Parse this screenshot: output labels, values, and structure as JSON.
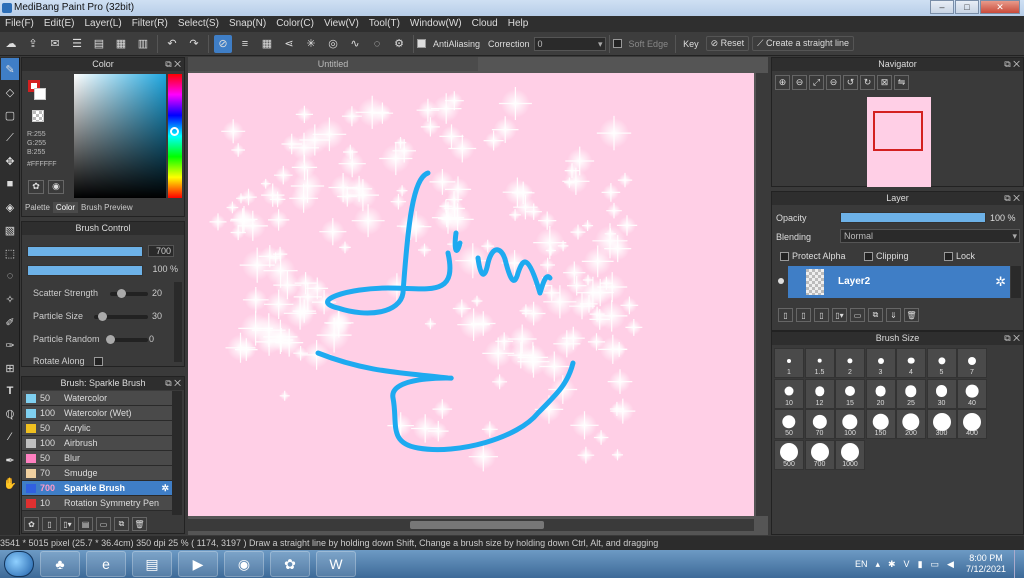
{
  "window": {
    "title": "MediBang Paint Pro (32bit)"
  },
  "menu": [
    "File(F)",
    "Edit(E)",
    "Layer(L)",
    "Filter(R)",
    "Select(S)",
    "Snap(N)",
    "Color(C)",
    "View(V)",
    "Tool(T)",
    "Window(W)",
    "Cloud",
    "Help"
  ],
  "toolbar": {
    "antialiasing": "AntiAliasing",
    "correction_label": "Correction",
    "correction_value": "0",
    "soft_edge": "Soft Edge",
    "key_label": "Key",
    "reset": "Reset",
    "straight_line": "Create a straight line"
  },
  "color_panel": {
    "title": "Color",
    "r": "R:255",
    "g": "G:255",
    "b": "B:255",
    "hex": "#FFFFFF",
    "tabs": [
      "Palette",
      "Color",
      "Brush Preview"
    ],
    "foreground": "#d42020",
    "background": "#ffffff"
  },
  "brush_control": {
    "title": "Brush Control",
    "size_value": "700",
    "opacity_value": "100 %",
    "sliders": [
      {
        "label": "Scatter Strength",
        "value": "20",
        "pos": 0.3
      },
      {
        "label": "Particle Size",
        "value": "30",
        "pos": 0.2
      },
      {
        "label": "Particle Random",
        "value": "0",
        "pos": 0.0
      },
      {
        "label": "Rotate Along",
        "value": "",
        "pos": 0
      }
    ]
  },
  "brush_list": {
    "title": "Brush: Sparkle Brush",
    "items": [
      {
        "size": "50",
        "name": "Watercolor",
        "color": "#7fd0f0"
      },
      {
        "size": "100",
        "name": "Watercolor (Wet)",
        "color": "#7fd0f0"
      },
      {
        "size": "50",
        "name": "Acrylic",
        "color": "#f0c020"
      },
      {
        "size": "100",
        "name": "Airbrush",
        "color": "#c0c0c0"
      },
      {
        "size": "50",
        "name": "Blur",
        "color": "#ff80c0"
      },
      {
        "size": "70",
        "name": "Smudge",
        "color": "#f0d0a0"
      },
      {
        "size": "700",
        "name": "Sparkle Brush",
        "color": "#3060e0"
      },
      {
        "size": "10",
        "name": "Rotation Symmetry Pen",
        "color": "#e03030"
      }
    ]
  },
  "canvas": {
    "tab": "Untitled",
    "bg": "#ffcfe6",
    "stroke": "#1eaaf0"
  },
  "navigator": {
    "title": "Navigator"
  },
  "layer_panel": {
    "title": "Layer",
    "opacity_label": "Opacity",
    "opacity_value": "100 %",
    "blending_label": "Blending",
    "blending_value": "Normal",
    "protect_alpha": "Protect Alpha",
    "clipping": "Clipping",
    "lock": "Lock",
    "layer_name": "Layer2"
  },
  "brush_size_panel": {
    "title": "Brush Size",
    "sizes": [
      "1",
      "1.5",
      "2",
      "3",
      "4",
      "5",
      "7",
      "10",
      "12",
      "15",
      "20",
      "25",
      "30",
      "40",
      "50",
      "70",
      "100",
      "150",
      "200",
      "300",
      "400",
      "500",
      "700",
      "1000"
    ]
  },
  "status": {
    "text": "3541 * 5015 pixel  (25.7 * 36.4cm)  350 dpi  25 %  ( 1174, 3197 )  Draw a straight line by holding down Shift, Change a brush size by holding down Ctrl, Alt, and dragging"
  },
  "taskbar": {
    "lang": "EN",
    "time": "8:00 PM",
    "date": "7/12/2021"
  }
}
